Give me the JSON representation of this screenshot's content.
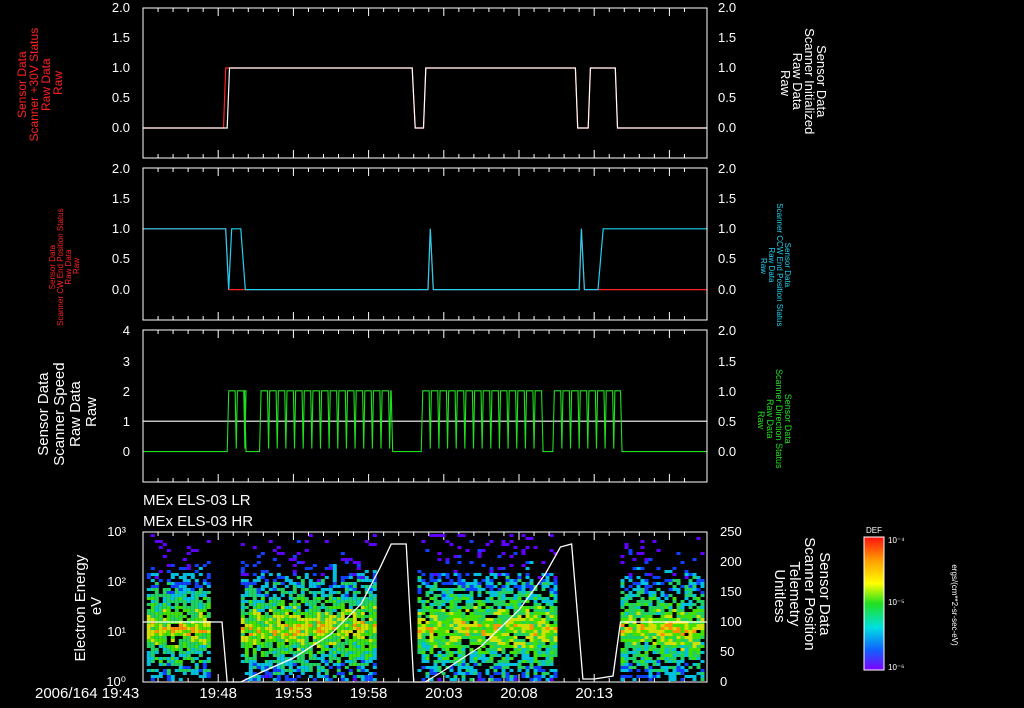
{
  "chart_data": [
    {
      "type": "line",
      "series": [
        {
          "name": "Sensor Data Scanner +30V Status Raw Data Raw",
          "color": "#ff2020",
          "points": [
            [
              0,
              0
            ],
            [
              1.07,
              0
            ],
            [
              1.1,
              1
            ],
            [
              3.58,
              1
            ],
            [
              3.62,
              0
            ],
            [
              3.73,
              0
            ],
            [
              3.76,
              1
            ],
            [
              5.75,
              1
            ],
            [
              5.78,
              0
            ],
            [
              5.92,
              0
            ],
            [
              5.95,
              1
            ],
            [
              6.28,
              1
            ],
            [
              6.31,
              0
            ],
            [
              7.5,
              0
            ]
          ]
        },
        {
          "name": "Sensor Data Scanner Initialized Raw Data Raw",
          "color": "#ffffff",
          "points": [
            [
              0,
              0
            ],
            [
              1.12,
              0
            ],
            [
              1.15,
              1
            ],
            [
              3.58,
              1
            ],
            [
              3.62,
              0
            ],
            [
              3.73,
              0
            ],
            [
              3.76,
              1
            ],
            [
              5.75,
              1
            ],
            [
              5.78,
              0
            ],
            [
              5.92,
              0
            ],
            [
              5.95,
              1
            ],
            [
              6.28,
              1
            ],
            [
              6.31,
              0
            ],
            [
              7.5,
              0
            ]
          ]
        }
      ],
      "ylabel_left": [
        "Sensor Data",
        "Scanner +30V Status",
        "Raw Data",
        "Raw"
      ],
      "ylabel_right": [
        "Sensor Data",
        "Scanner Initialized",
        "Raw Data",
        "Raw"
      ],
      "left_ticks": [
        "2.0",
        "1.5",
        "1.0",
        "0.5",
        "0.0"
      ],
      "right_ticks": [
        "2.0",
        "1.5",
        "1.0",
        "0.5",
        "0.0"
      ],
      "ylim": [
        -0.5,
        2.0
      ]
    },
    {
      "type": "line",
      "series": [
        {
          "name": "Sensor Data Scanner CW End Position Status Raw Data Raw",
          "color": "#ff2020",
          "points": [
            [
              0,
              1
            ],
            [
              1.1,
              1
            ],
            [
              1.14,
              0
            ],
            [
              3.79,
              0
            ],
            [
              3.82,
              1
            ],
            [
              3.86,
              0
            ],
            [
              5.8,
              0
            ],
            [
              5.83,
              1
            ],
            [
              5.87,
              0
            ],
            [
              7.5,
              0
            ]
          ]
        },
        {
          "name": "Sensor Data Scanner CCW End Position Status Raw Data Raw",
          "color": "#20d0f0",
          "points": [
            [
              0,
              1
            ],
            [
              1.1,
              1
            ],
            [
              1.14,
              0
            ],
            [
              1.18,
              1
            ],
            [
              1.3,
              1
            ],
            [
              1.36,
              0
            ],
            [
              3.79,
              0
            ],
            [
              3.82,
              1
            ],
            [
              3.86,
              0
            ],
            [
              5.8,
              0
            ],
            [
              5.83,
              1
            ],
            [
              5.87,
              0
            ],
            [
              6.05,
              0
            ],
            [
              6.12,
              1
            ],
            [
              7.5,
              1
            ]
          ]
        }
      ],
      "ylabel_left": [
        "Sensor Data",
        "Scanner CW End Position Status",
        "Raw Data",
        "Raw"
      ],
      "ylabel_right": [
        "Sensor Data",
        "Scanner CCW End Position Status",
        "Raw Data",
        "Raw"
      ],
      "left_ticks": [
        "2.0",
        "1.5",
        "1.0",
        "0.5",
        "0.0"
      ],
      "right_ticks": [
        "2.0",
        "1.5",
        "1.0",
        "0.5",
        "0.0"
      ],
      "ylim": [
        -0.5,
        2.0
      ]
    },
    {
      "type": "line",
      "series": [
        {
          "name": "Sensor Data Scanner Speed Raw Data Raw",
          "color": "#ffffff",
          "points": [
            [
              0,
              1
            ],
            [
              7.5,
              1
            ]
          ]
        },
        {
          "name": "Sensor Data Scanner Direction Status Raw Data Raw",
          "color": "#20e020",
          "pattern": {
            "high_segments": [
              [
                1.12,
                1.35
              ],
              [
                1.55,
                3.3
              ],
              [
                3.7,
                5.3
              ],
              [
                5.45,
                6.35
              ]
            ],
            "dip_period": 0.085,
            "value_high": 2,
            "value_low": 0
          }
        }
      ],
      "ylabel_left": [
        "Sensor Data",
        "Scanner Speed",
        "Raw Data",
        "Raw"
      ],
      "ylabel_right": [
        "Sensor Data",
        "Scanner Direction Status",
        "Raw Data",
        "Raw"
      ],
      "left_ticks": [
        "4",
        "3",
        "2",
        "1",
        "0"
      ],
      "right_ticks": [
        "2.0",
        "1.5",
        "1.0",
        "0.5",
        "0.0"
      ],
      "ylim": [
        -1,
        4
      ]
    },
    {
      "type": "heatmap",
      "labels_above": [
        "MEx ELS-03 LR",
        "MEx ELS-03 HR"
      ],
      "ylabel_left": [
        "Electron Energy",
        "eV"
      ],
      "ylabel_right": [
        "Sensor Data",
        "Scanner Position",
        "Telemetry",
        "Unitless"
      ],
      "left_ticks": [
        "10³",
        "10²",
        "10¹",
        "10⁰"
      ],
      "right_ticks": [
        "250",
        "200",
        "150",
        "100",
        "50",
        "0"
      ],
      "ylim_log": [
        0,
        3
      ],
      "ylim_right": [
        0,
        250
      ],
      "data_blocks": [
        [
          0.05,
          0.85
        ],
        [
          1.3,
          3.1
        ],
        [
          3.65,
          5.5
        ],
        [
          6.35,
          7.45
        ]
      ],
      "scanner_position": {
        "color": "#ffffff",
        "points": [
          [
            0,
            100
          ],
          [
            1.05,
            100
          ],
          [
            1.12,
            0
          ],
          [
            1.3,
            0
          ],
          [
            1.55,
            15
          ],
          [
            2.0,
            40
          ],
          [
            2.5,
            80
          ],
          [
            2.9,
            130
          ],
          [
            3.15,
            190
          ],
          [
            3.3,
            230
          ],
          [
            3.5,
            230
          ],
          [
            3.6,
            0
          ],
          [
            3.75,
            0
          ],
          [
            3.95,
            15
          ],
          [
            4.5,
            60
          ],
          [
            5.0,
            120
          ],
          [
            5.35,
            180
          ],
          [
            5.55,
            225
          ],
          [
            5.7,
            230
          ],
          [
            5.85,
            5
          ],
          [
            6.0,
            5
          ],
          [
            6.25,
            10
          ],
          [
            6.35,
            100
          ],
          [
            7.5,
            100
          ]
        ]
      },
      "colorbar": {
        "label": "DEF",
        "units": "ergs/(cm**2-sr-sec-eV)",
        "ticks": [
          "10⁻⁴",
          "10⁻⁵",
          "10⁻⁶"
        ]
      }
    }
  ],
  "time_axis": {
    "start_label": "2006/164 19:43",
    "tick_labels": [
      "19:48",
      "19:53",
      "19:58",
      "20:03",
      "20:08",
      "20:13"
    ]
  }
}
